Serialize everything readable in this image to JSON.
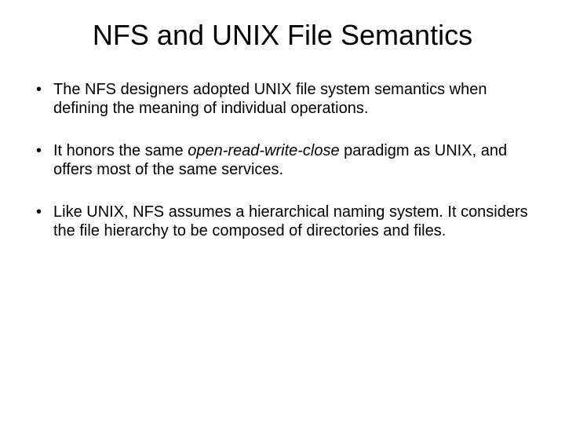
{
  "title": "NFS and UNIX File Semantics",
  "bullets": [
    {
      "pre": "The NFS designers adopted UNIX file system semantics when defining the meaning of individual operations.",
      "em": "",
      "post": ""
    },
    {
      "pre": "It honors the same ",
      "em": "open-read-write-close",
      "post": " paradigm as UNIX, and offers most of the same services."
    },
    {
      "pre": "Like UNIX, NFS assumes a hierarchical naming system. It considers the file hierarchy to be composed of directories and files.",
      "em": "",
      "post": ""
    }
  ]
}
